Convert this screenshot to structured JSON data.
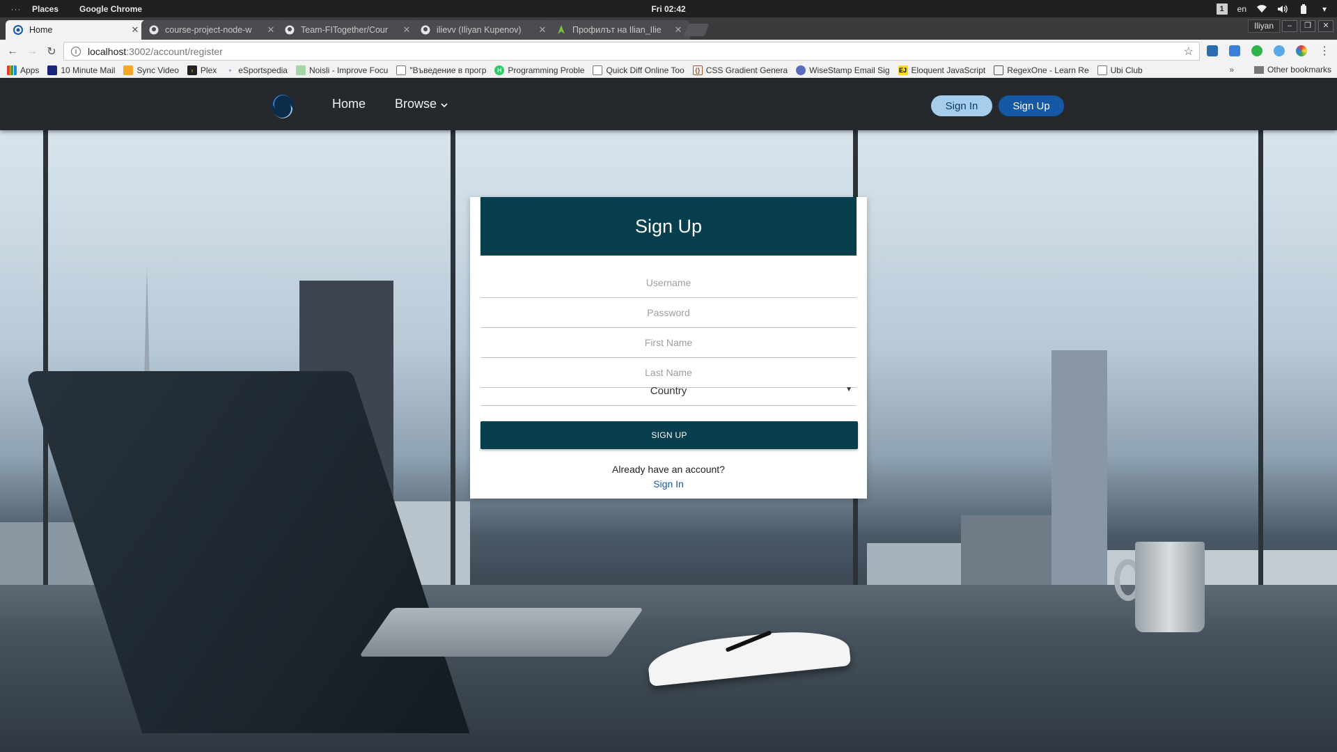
{
  "os": {
    "dots": "···",
    "menu_places": "Places",
    "menu_app": "Google Chrome",
    "clock": "Fri 02:42",
    "workspace": "1",
    "lang": "en"
  },
  "browser": {
    "tabs": [
      {
        "title": "Home"
      },
      {
        "title": "course-project-node-w"
      },
      {
        "title": "Team-FITogether/Cour"
      },
      {
        "title": "ilievv (Iliyan Kupenov)"
      },
      {
        "title": "Профилът на Ilian_Ilie"
      }
    ],
    "profile": "Iliyan",
    "url_host": "localhost",
    "url_path": ":3002/account/register",
    "bookmarks": [
      {
        "label": "Apps",
        "icon": "apps-grid-icon"
      },
      {
        "label": "10 Minute Mail",
        "icon": "mail-icon"
      },
      {
        "label": "Sync Video",
        "icon": "sync-video-icon"
      },
      {
        "label": "Plex",
        "icon": "plex-icon"
      },
      {
        "label": "eSportspedia",
        "icon": "trophy-icon"
      },
      {
        "label": "Noisli - Improve Focu",
        "icon": "noisli-icon"
      },
      {
        "label": "\"Въведение в прогр",
        "icon": "page-icon"
      },
      {
        "label": "Programming Proble",
        "icon": "hackerrank-icon"
      },
      {
        "label": "Quick Diff Online Too",
        "icon": "page-icon"
      },
      {
        "label": "CSS Gradient Genera",
        "icon": "css-gradient-icon"
      },
      {
        "label": "WiseStamp Email Sig",
        "icon": "wisestamp-icon"
      },
      {
        "label": "Eloquent JavaScript",
        "icon": "ejs-icon"
      },
      {
        "label": "RegexOne - Learn Re",
        "icon": "regex-icon"
      },
      {
        "label": "Ubi Club",
        "icon": "page-icon"
      }
    ],
    "bookmarks_overflow": "»",
    "other_bookmarks": "Other bookmarks"
  },
  "app": {
    "nav": {
      "home": "Home",
      "browse": "Browse",
      "sign_in": "Sign In",
      "sign_up": "Sign Up"
    },
    "form": {
      "title": "Sign Up",
      "username_placeholder": "Username",
      "password_placeholder": "Password",
      "first_name_placeholder": "First Name",
      "last_name_placeholder": "Last Name",
      "country_selected": "Country",
      "submit": "SIGN UP",
      "have_account": "Already have an account?",
      "sign_in_link": "Sign In"
    }
  },
  "colors": {
    "card_header": "#073f4e",
    "nav_bg": "#25292e",
    "signup_btn": "#1558a6",
    "signin_btn": "#a7cdec"
  }
}
